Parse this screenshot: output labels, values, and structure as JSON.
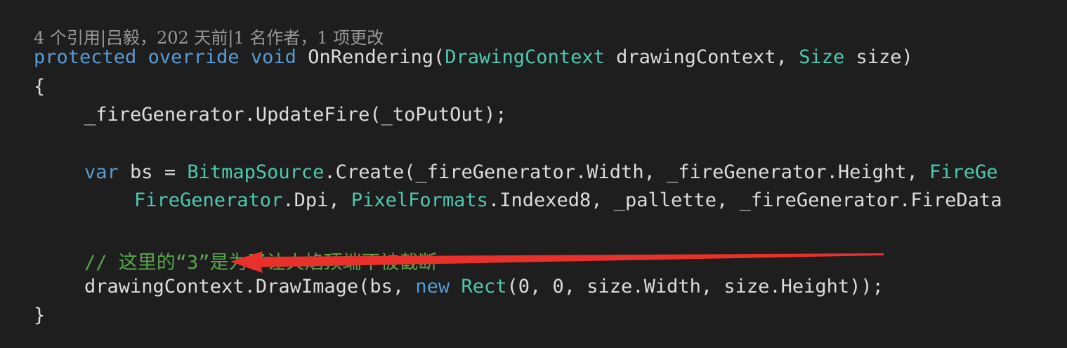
{
  "codelens": "4 个引用|吕毅，202 天前|1 名作者，1 项更改",
  "code": {
    "line1": {
      "kw1": "protected",
      "kw2": "override",
      "kw3": "void",
      "method": "OnRendering(",
      "type1": "DrawingContext",
      "param1": "drawingContext,",
      "type2": "Size",
      "param2": "size)"
    },
    "line2": {
      "brace": "{"
    },
    "line3": {
      "text": "_fireGenerator.UpdateFire(_toPutOut);"
    },
    "line4": {
      "kw": "var",
      "mid": "bs =",
      "type": "BitmapSource",
      "rest": ".Create(_fireGenerator.Width, _fireGenerator.Height,",
      "tail": "FireGe"
    },
    "line5": {
      "type1": "FireGenerator",
      "p1": ".Dpi,",
      "type2": "PixelFormats",
      "rest": ".Indexed8, _pallette, _fireGenerator.FireData"
    },
    "line6": {
      "comment": "// 这里的“3”是为了让火焰顶端不被截断"
    },
    "line7": {
      "pre": "drawingContext.DrawImage(bs,",
      "kw": "new",
      "type": "Rect",
      "rest": "(0, 0, size.Width, size.Height));"
    },
    "line8": {
      "brace": "}"
    }
  },
  "colors": {
    "background": "#1e1e1e",
    "keyword": "#569cd6",
    "type": "#4ec9b0",
    "comment": "#57a64a",
    "text": "#dcdcdc",
    "codelens": "#999999",
    "annotation_arrow": "#e8312b"
  },
  "annotation": {
    "icon": "red-arrow-icon"
  }
}
